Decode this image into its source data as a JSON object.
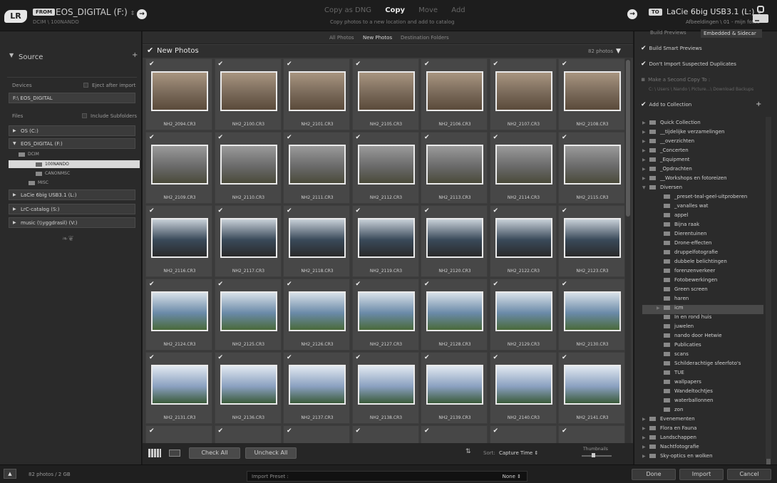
{
  "app": {
    "logo": "LR"
  },
  "header": {
    "from_badge": "FROM",
    "source_name": "EOS_DIGITAL (F:)",
    "source_path": "DCIM \\ 100NANDO",
    "modes": [
      "Copy as DNG",
      "Copy",
      "Move",
      "Add"
    ],
    "active_mode": "Copy",
    "mode_desc": "Copy photos to a new location and add to catalog",
    "to_badge": "TO",
    "dest_name": "LaCie 6big USB3.1 (L:)",
    "dest_path": "Afbeeldingen \\ 01 - mijn fotos"
  },
  "left": {
    "source_title": "Source",
    "devices_label": "Devices",
    "eject_label": "Eject after import",
    "path": "F:\\ EOS_DIGITAL",
    "files_label": "Files",
    "subfolders_label": "Include Subfolders",
    "drives": [
      "OS (C:)",
      "EOS_DIGITAL (F:)",
      "LaCie 6big USB3.1 (L:)",
      "LrC-catalog (S:)",
      "music (\\\\yggdrasil) (V:)"
    ],
    "folders": [
      "DCIM",
      "100NANDO",
      "CANONMSC",
      "MISC"
    ]
  },
  "center": {
    "tabs": [
      "All Photos",
      "New Photos",
      "Destination Folders"
    ],
    "new_title": "New Photos",
    "count": "82 photos",
    "photos": [
      "NH2_2094.CR3",
      "NH2_2100.CR3",
      "NH2_2101.CR3",
      "NH2_2105.CR3",
      "NH2_2106.CR3",
      "NH2_2107.CR3",
      "NH2_2108.CR3",
      "NH2_2109.CR3",
      "NH2_2110.CR3",
      "NH2_2111.CR3",
      "NH2_2112.CR3",
      "NH2_2113.CR3",
      "NH2_2114.CR3",
      "NH2_2115.CR3",
      "NH2_2116.CR3",
      "NH2_2117.CR3",
      "NH2_2118.CR3",
      "NH2_2119.CR3",
      "NH2_2120.CR3",
      "NH2_2122.CR3",
      "NH2_2123.CR3",
      "NH2_2124.CR3",
      "NH2_2125.CR3",
      "NH2_2126.CR3",
      "NH2_2127.CR3",
      "NH2_2128.CR3",
      "NH2_2129.CR3",
      "NH2_2130.CR3",
      "NH2_2131.CR3",
      "NH2_2136.CR3",
      "NH2_2137.CR3",
      "NH2_2138.CR3",
      "NH2_2139.CR3",
      "NH2_2140.CR3",
      "NH2_2141.CR3",
      "",
      "",
      "",
      "",
      "",
      "",
      ""
    ],
    "check_all": "Check All",
    "uncheck_all": "Uncheck All",
    "sort_label": "Sort:",
    "sort_value": "Capture Time",
    "thumbnails_label": "Thumbnails"
  },
  "right": {
    "build_previews_label": "Build Previews",
    "build_previews_value": "Embedded & Sidecar",
    "smart_previews": "Build Smart Previews",
    "dont_import": "Don't Import Suspected Duplicates",
    "second_copy": "Make a Second Copy To :",
    "second_copy_path": "C: \\ Users \\ Nando \\ Picture...\\ Download Backups",
    "add_to_collection": "Add to Collection",
    "collections": [
      "Quick Collection",
      "__tijdelijke verzamelingen",
      "__overzichten",
      "_Concerten",
      "_Equipment",
      "_Opdrachten",
      "__Workshops en fotoreizen",
      "Diversen",
      "_preset-teal-geel-uitproberen",
      "_vanalles wat",
      "appel",
      "Bijna raak",
      "Dierentuinen",
      "Drone-effecten",
      "druppelfotografie",
      "dubbele belichtingen",
      "forenzenverkeer",
      "Fotobewerkingen",
      "Green screen",
      "haren",
      "icm",
      "In en rond huis",
      "juwelen",
      "nando door Hetwie",
      "Publicaties",
      "scans",
      "Schilderachtige sfeerfoto's",
      "TUE",
      "wallpapers",
      "Wandeltochtjes",
      "waterballonnen",
      "zon",
      "Evenementen",
      "Flora en Fauna",
      "Landschappen",
      "Nachtfotografie",
      "Sky-optics en wolken"
    ]
  },
  "bottom": {
    "status": "82 photos / 2 GB",
    "preset_label": "Import Preset :",
    "preset_value": "None",
    "done": "Done",
    "import": "Import",
    "cancel": "Cancel"
  }
}
